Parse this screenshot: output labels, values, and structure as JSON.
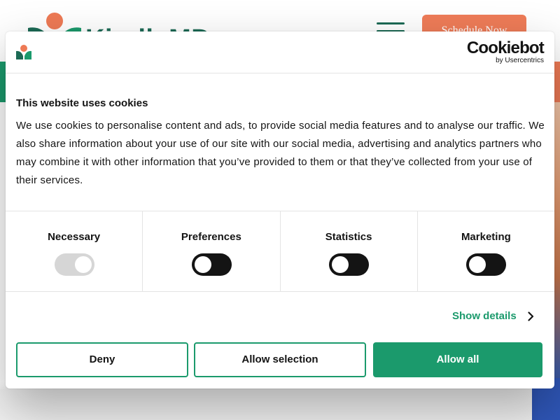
{
  "site": {
    "brand_name": "KindlyMD",
    "schedule_label": "Schedule Now"
  },
  "cookie_dialog": {
    "provider_name": "Cookiebot",
    "provider_sub": "by Usercentrics",
    "title": "This website uses cookies",
    "body": "We use cookies to personalise content and ads, to provide social media features and to analyse our traffic. We also share information about your use of our site with our social media, advertising and analytics partners who may combine it with other information that you’ve provided to them or that they’ve collected from your use of their services.",
    "categories": [
      {
        "label": "Necessary",
        "checked": true,
        "disabled": true
      },
      {
        "label": "Preferences",
        "checked": false,
        "disabled": false
      },
      {
        "label": "Statistics",
        "checked": false,
        "disabled": false
      },
      {
        "label": "Marketing",
        "checked": false,
        "disabled": false
      }
    ],
    "show_details_label": "Show details",
    "buttons": {
      "deny": "Deny",
      "allow_selection": "Allow selection",
      "allow_all": "Allow all"
    }
  },
  "colors": {
    "accent_green": "#1b9a6c",
    "brand_dark_green": "#1c6a55",
    "brand_orange": "#ef7c58",
    "toggle_off": "#141414",
    "toggle_disabled": "#d6d6d6"
  },
  "icons": {
    "dialog_logo": "kindlymd-flower-icon",
    "show_details_chevron": "chevron-right-icon",
    "menu": "hamburger-icon"
  }
}
